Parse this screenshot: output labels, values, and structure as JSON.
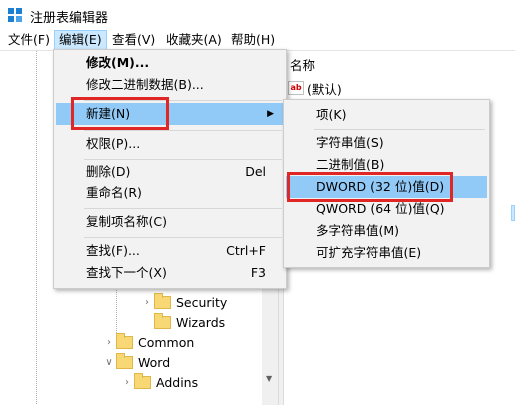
{
  "window": {
    "title": "注册表编辑器"
  },
  "menubar": [
    {
      "label": "文件(F)"
    },
    {
      "label": "编辑(E)"
    },
    {
      "label": "查看(V)"
    },
    {
      "label": "收藏夹(A)"
    },
    {
      "label": "帮助(H)"
    }
  ],
  "edit_menu": {
    "modify": "修改(M)...",
    "modify_binary": "修改二进制数据(B)...",
    "new": "新建(N)",
    "permissions": "权限(P)...",
    "delete": "删除(D)",
    "delete_shortcut": "Del",
    "rename": "重命名(R)",
    "copy_key_name": "复制项名称(C)",
    "find": "查找(F)...",
    "find_shortcut": "Ctrl+F",
    "find_next": "查找下一个(X)",
    "find_next_shortcut": "F3"
  },
  "new_submenu": {
    "key": "项(K)",
    "string_value": "字符串值(S)",
    "binary_value": "二进制值(B)",
    "dword_value": "DWORD (32 位)值(D)",
    "qword_value": "QWORD (64 位)值(Q)",
    "multi_string_value": "多字符串值(M)",
    "expandable_string_value": "可扩充字符串值(E)"
  },
  "list_pane": {
    "column_name": "名称",
    "default_value": "(默认)",
    "default_icon": "ab"
  },
  "tree": [
    {
      "label": "Security"
    },
    {
      "label": "Wizards"
    },
    {
      "label": "Common"
    },
    {
      "label": "Word"
    },
    {
      "label": "Addins"
    }
  ],
  "colors": {
    "highlight": "#91c9f7",
    "annotation_red": "#e12626",
    "folder_yellow": "#f8d775"
  }
}
